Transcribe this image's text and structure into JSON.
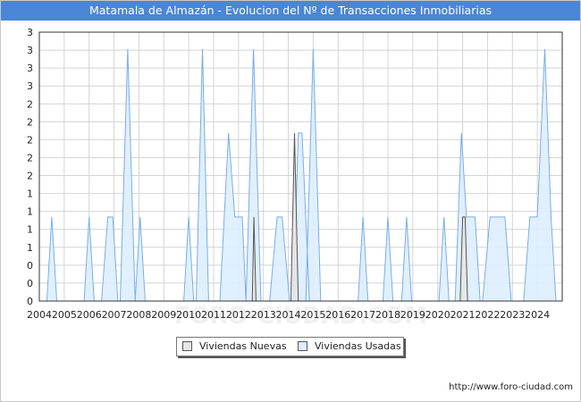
{
  "title": "Matamala de Almazán - Evolucion del Nº de Transacciones Inmobiliarias",
  "footer": "http://www.foro-ciudad.com",
  "watermark": "FORO-CIUDAD.COM",
  "colors": {
    "title_bg": "#4a86d4",
    "nuevas_fill": "#e6e6e6",
    "nuevas_line": "#555555",
    "usadas_fill": "#ddeeff",
    "usadas_line": "#7aaee6",
    "grid": "#d4d4d4"
  },
  "chart_data": {
    "type": "area",
    "title": "Matamala de Almazán - Evolucion del Nº de Transacciones Inmobiliarias",
    "xlabel": "",
    "ylabel": "",
    "x_tick_labels": [
      "2004",
      "2005",
      "2006",
      "2007",
      "2008",
      "2009",
      "2010",
      "2011",
      "2012",
      "2013",
      "2014",
      "2015",
      "2016",
      "2017",
      "2018",
      "2019",
      "2020",
      "2021",
      "2022",
      "2023",
      "2024"
    ],
    "y_tick_labels": [
      "0",
      "0",
      "0",
      "1",
      "1",
      "1",
      "1",
      "2",
      "2",
      "2",
      "2",
      "2",
      "3",
      "3",
      "3",
      "3"
    ],
    "x_range": [
      2004.0,
      2025.0
    ],
    "ylim": [
      0,
      3.2
    ],
    "grid": true,
    "legend_position": "bottom-center",
    "series": [
      {
        "name": "Viviendas Nuevas",
        "points": [
          {
            "x": 2012.55,
            "y": 0
          },
          {
            "x": 2012.62,
            "y": 1
          },
          {
            "x": 2012.7,
            "y": 0
          },
          {
            "x": 2014.1,
            "y": 0
          },
          {
            "x": 2014.25,
            "y": 2
          },
          {
            "x": 2014.4,
            "y": 0
          },
          {
            "x": 2020.9,
            "y": 0
          },
          {
            "x": 2021.0,
            "y": 1
          },
          {
            "x": 2021.1,
            "y": 1
          },
          {
            "x": 2021.2,
            "y": 0
          }
        ]
      },
      {
        "name": "Viviendas Usadas",
        "points": [
          {
            "x": 2004.3,
            "y": 0
          },
          {
            "x": 2004.5,
            "y": 1
          },
          {
            "x": 2004.7,
            "y": 0
          },
          {
            "x": 2005.8,
            "y": 0
          },
          {
            "x": 2006.0,
            "y": 1
          },
          {
            "x": 2006.2,
            "y": 0
          },
          {
            "x": 2006.5,
            "y": 0
          },
          {
            "x": 2006.75,
            "y": 1
          },
          {
            "x": 2006.95,
            "y": 1
          },
          {
            "x": 2007.15,
            "y": 0
          },
          {
            "x": 2007.25,
            "y": 0
          },
          {
            "x": 2007.55,
            "y": 3
          },
          {
            "x": 2007.85,
            "y": 0
          },
          {
            "x": 2007.85,
            "y": 0
          },
          {
            "x": 2008.05,
            "y": 1
          },
          {
            "x": 2008.25,
            "y": 0
          },
          {
            "x": 2009.8,
            "y": 0
          },
          {
            "x": 2010.0,
            "y": 1
          },
          {
            "x": 2010.2,
            "y": 0
          },
          {
            "x": 2010.3,
            "y": 0
          },
          {
            "x": 2010.55,
            "y": 3
          },
          {
            "x": 2010.8,
            "y": 0
          },
          {
            "x": 2011.25,
            "y": 0
          },
          {
            "x": 2011.6,
            "y": 2
          },
          {
            "x": 2011.85,
            "y": 1
          },
          {
            "x": 2012.15,
            "y": 1
          },
          {
            "x": 2012.3,
            "y": 0
          },
          {
            "x": 2012.3,
            "y": 0
          },
          {
            "x": 2012.6,
            "y": 3
          },
          {
            "x": 2012.9,
            "y": 0
          },
          {
            "x": 2013.25,
            "y": 0
          },
          {
            "x": 2013.55,
            "y": 1
          },
          {
            "x": 2013.75,
            "y": 1
          },
          {
            "x": 2014.05,
            "y": 0
          },
          {
            "x": 2014.2,
            "y": 0
          },
          {
            "x": 2014.4,
            "y": 2
          },
          {
            "x": 2014.55,
            "y": 2
          },
          {
            "x": 2014.85,
            "y": 0
          },
          {
            "x": 2014.7,
            "y": 0
          },
          {
            "x": 2015.0,
            "y": 3
          },
          {
            "x": 2015.3,
            "y": 0
          },
          {
            "x": 2016.8,
            "y": 0
          },
          {
            "x": 2017.0,
            "y": 1
          },
          {
            "x": 2017.2,
            "y": 0
          },
          {
            "x": 2017.8,
            "y": 0
          },
          {
            "x": 2018.0,
            "y": 1
          },
          {
            "x": 2018.2,
            "y": 0
          },
          {
            "x": 2018.55,
            "y": 0
          },
          {
            "x": 2018.75,
            "y": 1
          },
          {
            "x": 2018.95,
            "y": 0
          },
          {
            "x": 2020.05,
            "y": 0
          },
          {
            "x": 2020.25,
            "y": 1
          },
          {
            "x": 2020.45,
            "y": 0
          },
          {
            "x": 2020.7,
            "y": 0
          },
          {
            "x": 2020.95,
            "y": 2
          },
          {
            "x": 2021.15,
            "y": 1
          },
          {
            "x": 2021.5,
            "y": 1
          },
          {
            "x": 2021.7,
            "y": 0
          },
          {
            "x": 2021.8,
            "y": 0
          },
          {
            "x": 2022.1,
            "y": 1
          },
          {
            "x": 2022.7,
            "y": 1
          },
          {
            "x": 2022.95,
            "y": 0
          },
          {
            "x": 2023.45,
            "y": 0
          },
          {
            "x": 2023.7,
            "y": 1
          },
          {
            "x": 2024.0,
            "y": 1
          },
          {
            "x": 2024.3,
            "y": 3
          },
          {
            "x": 2024.55,
            "y": 1
          },
          {
            "x": 2024.75,
            "y": 0
          }
        ]
      }
    ]
  },
  "legend": {
    "nuevas_label": "Viviendas Nuevas",
    "usadas_label": "Viviendas Usadas"
  }
}
